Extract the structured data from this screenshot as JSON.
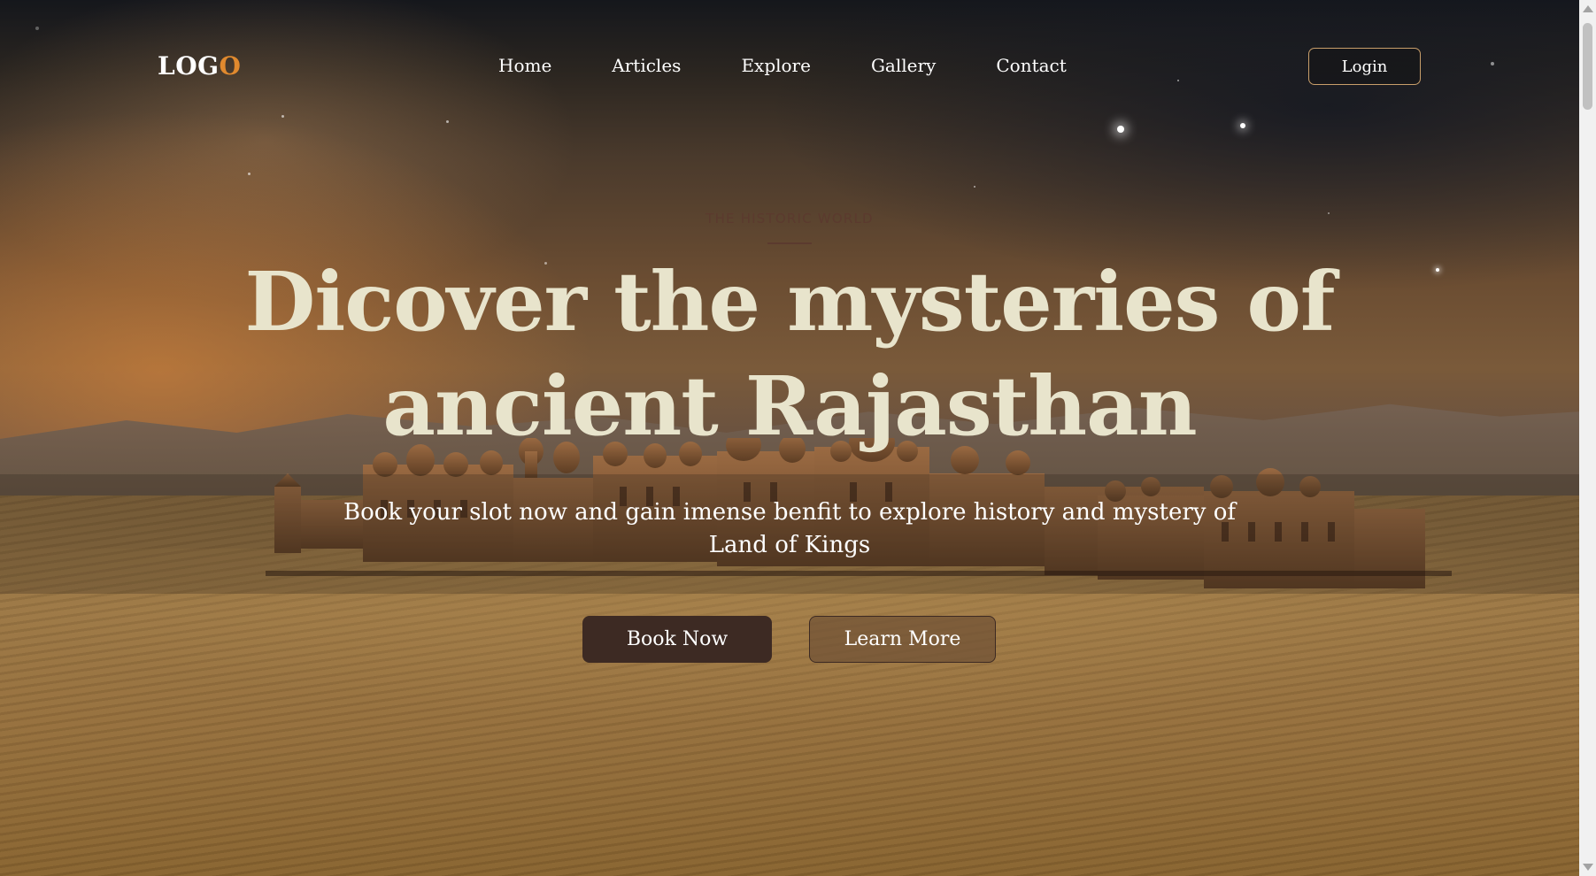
{
  "header": {
    "logo_main": "LOG",
    "logo_accent": "O",
    "nav": [
      {
        "label": "Home"
      },
      {
        "label": "Articles"
      },
      {
        "label": "Explore"
      },
      {
        "label": "Gallery"
      },
      {
        "label": "Contact"
      }
    ],
    "login_label": "Login"
  },
  "hero": {
    "eyebrow": "THE HISTORIC WORLD",
    "title_line1": "Dicover the mysteries of",
    "title_line2": "ancient Rajasthan",
    "subtitle": "Book your slot now and gain imense benfit to explore history and mystery of Land of Kings",
    "primary_button": "Book Now",
    "secondary_button": "Learn More"
  },
  "colors": {
    "logo_accent": "#e0892e",
    "title": "#e8e4cc",
    "eyebrow": "#5b3a2e",
    "primary_button_bg": "#3d2a23",
    "login_border": "#c89e6a"
  }
}
